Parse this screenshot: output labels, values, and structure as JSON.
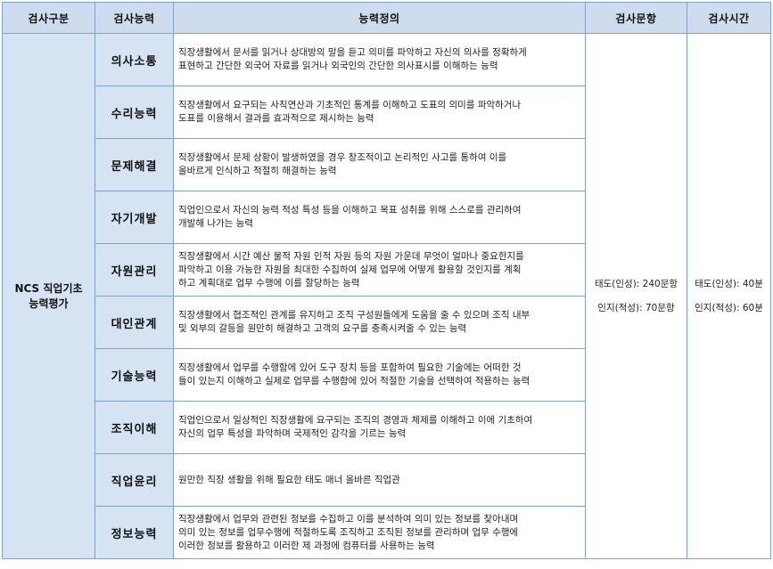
{
  "headers": {
    "category": "검사구분",
    "competency": "검사능력",
    "definition": "능력정의",
    "items": "검사문항",
    "time": "검사시간"
  },
  "category": {
    "line1": "NCS 직업기초",
    "line2": "능력평가"
  },
  "rows": [
    {
      "name": "의사소통",
      "definition": [
        "직장생활에서 문서를 읽거나 상대방의 말을 듣고 의미를 파악하고 자신의 의사를 정확하게",
        "표현하고 간단한 외국어 자료를 읽거나 외국인의 간단한 의사표시를 이해하는 능력"
      ]
    },
    {
      "name": "수리능력",
      "definition": [
        "직장생활에서 요구되는 사칙연산과 기초적인 통계를 이해하고 도표의 의미를 파악하거나",
        "도표를 이용해서 결과를 효과적으로 제시하는 능력"
      ]
    },
    {
      "name": "문제해결",
      "definition": [
        "직장생활에서 문제 상황이 발생하였을 경우 창조적이고 논리적인 사고를 통하여 이를",
        "올바르게 인식하고 적절히 해결하는 능력"
      ]
    },
    {
      "name": "자기개발",
      "definition": [
        "직업인으로서 자신의 능력 적성 특성 등을 이해하고 목표 성취를 위해 스스로를 관리하여",
        "개발해 나가는 능력"
      ]
    },
    {
      "name": "자원관리",
      "definition": [
        "직장생활에서 시간 예산 물적 자원 인적 자원 등의 자원 가운데 무엇이 얼마나 중요한지를",
        "파악하고 이용 가능한 자원을 최대한 수집하여 실제 업무에 어떻게 활용할 것인지를 계획",
        "하고 계획대로 업무 수행에 이를 할당하는 능력"
      ]
    },
    {
      "name": "대인관계",
      "definition": [
        "직장생활에서 협조적인 관계를 유지하고 조직 구성원들에게 도움을 줄 수 있으며 조직 내부",
        "및 외부의 갈등을 원만히 해결하고 고객의 요구를 충족시켜줄 수 있는 능력"
      ]
    },
    {
      "name": "기술능력",
      "definition": [
        "직장생활에서 업무를 수행함에 있어 도구 장치 등을 포함하여 필요한 기술에는 어떠한 것",
        "들이 있는지 이해하고 실제로 업무를 수행함에 있어 적절한 기술을 선택하여 적용하는 능력"
      ]
    },
    {
      "name": "조직이해",
      "definition": [
        "직업인으로서 일상적인 직장생활에 요구되는 조직의 경영과 체제를 이해하고 이에 기초하여",
        "자신의 업무 특성을 파악하며 국제적인 감각을 기르는 능력"
      ]
    },
    {
      "name": "직업윤리",
      "definition": [
        "원만한 직장 생활을 위해 필요한 태도 매너 올바른 직업관"
      ]
    },
    {
      "name": "정보능력",
      "definition": [
        "직장생활에서 업무와 관련된 정보를 수집하고 이를 분석하여 의미 있는 정보를 찾아내며",
        "의미 있는 정보를 업무수행에 적절하도록 조직하고 조직된 정보를 관리하며 업무 수행에",
        "이러한 정보를 활용하고 이러한 제 과정에 컴퓨터를 사용하는 능력"
      ]
    }
  ],
  "items": {
    "attitude": "태도(인성): 240문항",
    "cognitive": "인지(적성): 70문항"
  },
  "time": {
    "attitude": "태도(인성): 40분",
    "cognitive": "인지(적성): 60분"
  }
}
